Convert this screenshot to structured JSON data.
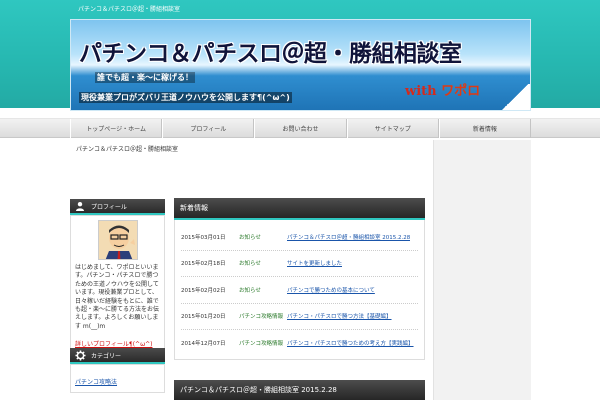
{
  "header": {
    "site_name": "パチンコ＆パチスロ＠超・勝組相談室",
    "banner": {
      "title": "パチンコ＆パチスロ＠超・勝組相談室",
      "sub1": "誰でも超・楽〜に稼げる！",
      "sub2": "現役兼業プロがズバリ王道ノウハウを公開します¶(^ω^)",
      "with": "with",
      "author": "ワポロ"
    }
  },
  "nav": {
    "items": [
      {
        "label": "トップページ・ホーム"
      },
      {
        "label": "プロフィール"
      },
      {
        "label": "お問い合わせ"
      },
      {
        "label": "サイトマップ"
      },
      {
        "label": "新着情報"
      }
    ]
  },
  "breadcrumb": "パチンコ＆パチスロ＠超・勝組相談室",
  "sidebar": {
    "profile": {
      "heading": "プロフィール",
      "text": "はじめまして、ワポロといいます。パチンコ・パチスロで勝つための王道ノウハウを公開しています。現役兼業プロとして、日々稼いだ経験をもとに、誰でも超・楽〜に勝てる方法をお伝えします。よろしくお願いします m(__)m",
      "link": "詳しいプロフィール¶(^ω^)"
    },
    "category": {
      "heading": "カテゴリー",
      "link": "パチンコ攻略法"
    }
  },
  "news": {
    "heading": "新着情報",
    "rows": [
      {
        "date": "2015年03月01日",
        "category": "お知らせ",
        "title": "パチンコ＆パチスロ＠超・勝組相談室 2015.2.28"
      },
      {
        "date": "2015年02月18日",
        "category": "お知らせ",
        "title": "サイトを更新しました"
      },
      {
        "date": "2015年02月02日",
        "category": "お知らせ",
        "title": "パチンコで勝つための基本について"
      },
      {
        "date": "2015年01月20日",
        "category": "パチンコ攻略情報",
        "title": "パチンコ・パチスロで勝つ方法【基礎編】"
      },
      {
        "date": "2014年12月07日",
        "category": "パチンコ攻略情報",
        "title": "パチンコ・パチスロで勝つための考え方【実践編】"
      }
    ]
  },
  "post": {
    "heading": "パチンコ＆パチスロ＠超・勝組相談室 2015.2.28"
  },
  "colors": {
    "accent": "#2fc7c0",
    "header_dark": "#2a2a2a",
    "link": "#1a55aa"
  }
}
